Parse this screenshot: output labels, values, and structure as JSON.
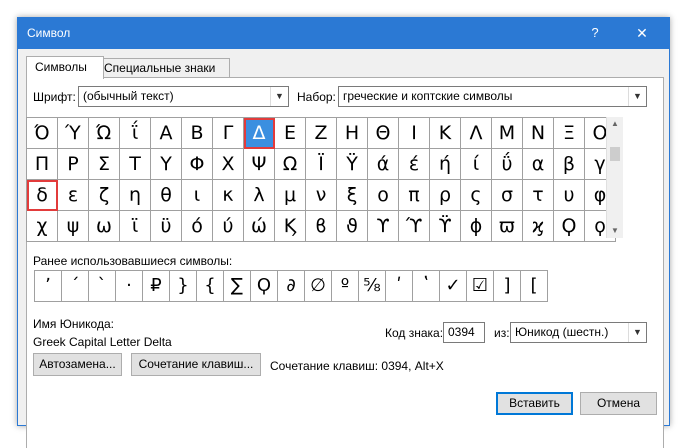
{
  "window": {
    "title": "Символ",
    "help": "?",
    "close": "✕"
  },
  "tabs": [
    {
      "label": "Символы",
      "active": true
    },
    {
      "label": "Специальные знаки",
      "active": false
    }
  ],
  "font": {
    "label": "Шрифт:",
    "value": "(обычный текст)"
  },
  "subset": {
    "label": "Набор:",
    "value": "греческие и коптские символы"
  },
  "grid": {
    "rows": [
      [
        "Ό",
        "Ύ",
        "Ώ",
        "ΐ",
        "Α",
        "Β",
        "Γ",
        "Δ",
        "Ε",
        "Ζ",
        "Η",
        "Θ",
        "Ι",
        "Κ",
        "Λ",
        "Μ",
        "Ν",
        "Ξ",
        "Ο"
      ],
      [
        "Π",
        "Ρ",
        "Σ",
        "Τ",
        "Υ",
        "Φ",
        "Χ",
        "Ψ",
        "Ω",
        "Ϊ",
        "Ϋ",
        "ά",
        "έ",
        "ή",
        "ί",
        "ΰ",
        "α",
        "β",
        "γ"
      ],
      [
        "δ",
        "ε",
        "ζ",
        "η",
        "θ",
        "ι",
        "κ",
        "λ",
        "μ",
        "ν",
        "ξ",
        "ο",
        "π",
        "ρ",
        "ς",
        "σ",
        "τ",
        "υ",
        "φ"
      ],
      [
        "χ",
        "ψ",
        "ω",
        "ϊ",
        "ϋ",
        "ό",
        "ύ",
        "ώ",
        "Ϗ",
        "ϐ",
        "ϑ",
        "ϒ",
        "ϓ",
        "ϔ",
        "ϕ",
        "ϖ",
        "ϗ",
        "Ϙ",
        "ϙ"
      ]
    ],
    "selected": [
      0,
      7
    ],
    "highlighted": [
      [
        0,
        7
      ],
      [
        2,
        0
      ]
    ]
  },
  "recent": {
    "label": "Ранее использовавшиеся символы:",
    "items": [
      "ʼ",
      "ˊ",
      "ˋ",
      "·",
      "₽",
      "}",
      "{",
      "∑",
      "Ϙ",
      "∂",
      "∅",
      "º",
      "⅝",
      "ʹ",
      "ʽ",
      "✓",
      "☑",
      "]",
      "["
    ]
  },
  "unicode_name": {
    "label": "Имя Юникода:",
    "value": "Greek Capital Letter Delta"
  },
  "char_code": {
    "label": "Код знака:",
    "value": "0394"
  },
  "from": {
    "label": "из:",
    "value": "Юникод (шестн.)"
  },
  "buttons": {
    "autocorrect": "Автозамена...",
    "shortcut_key": "Сочетание клавиш...",
    "insert": "Вставить",
    "cancel": "Отмена"
  },
  "shortcut_text": "Сочетание клавиш: 0394, Alt+X"
}
